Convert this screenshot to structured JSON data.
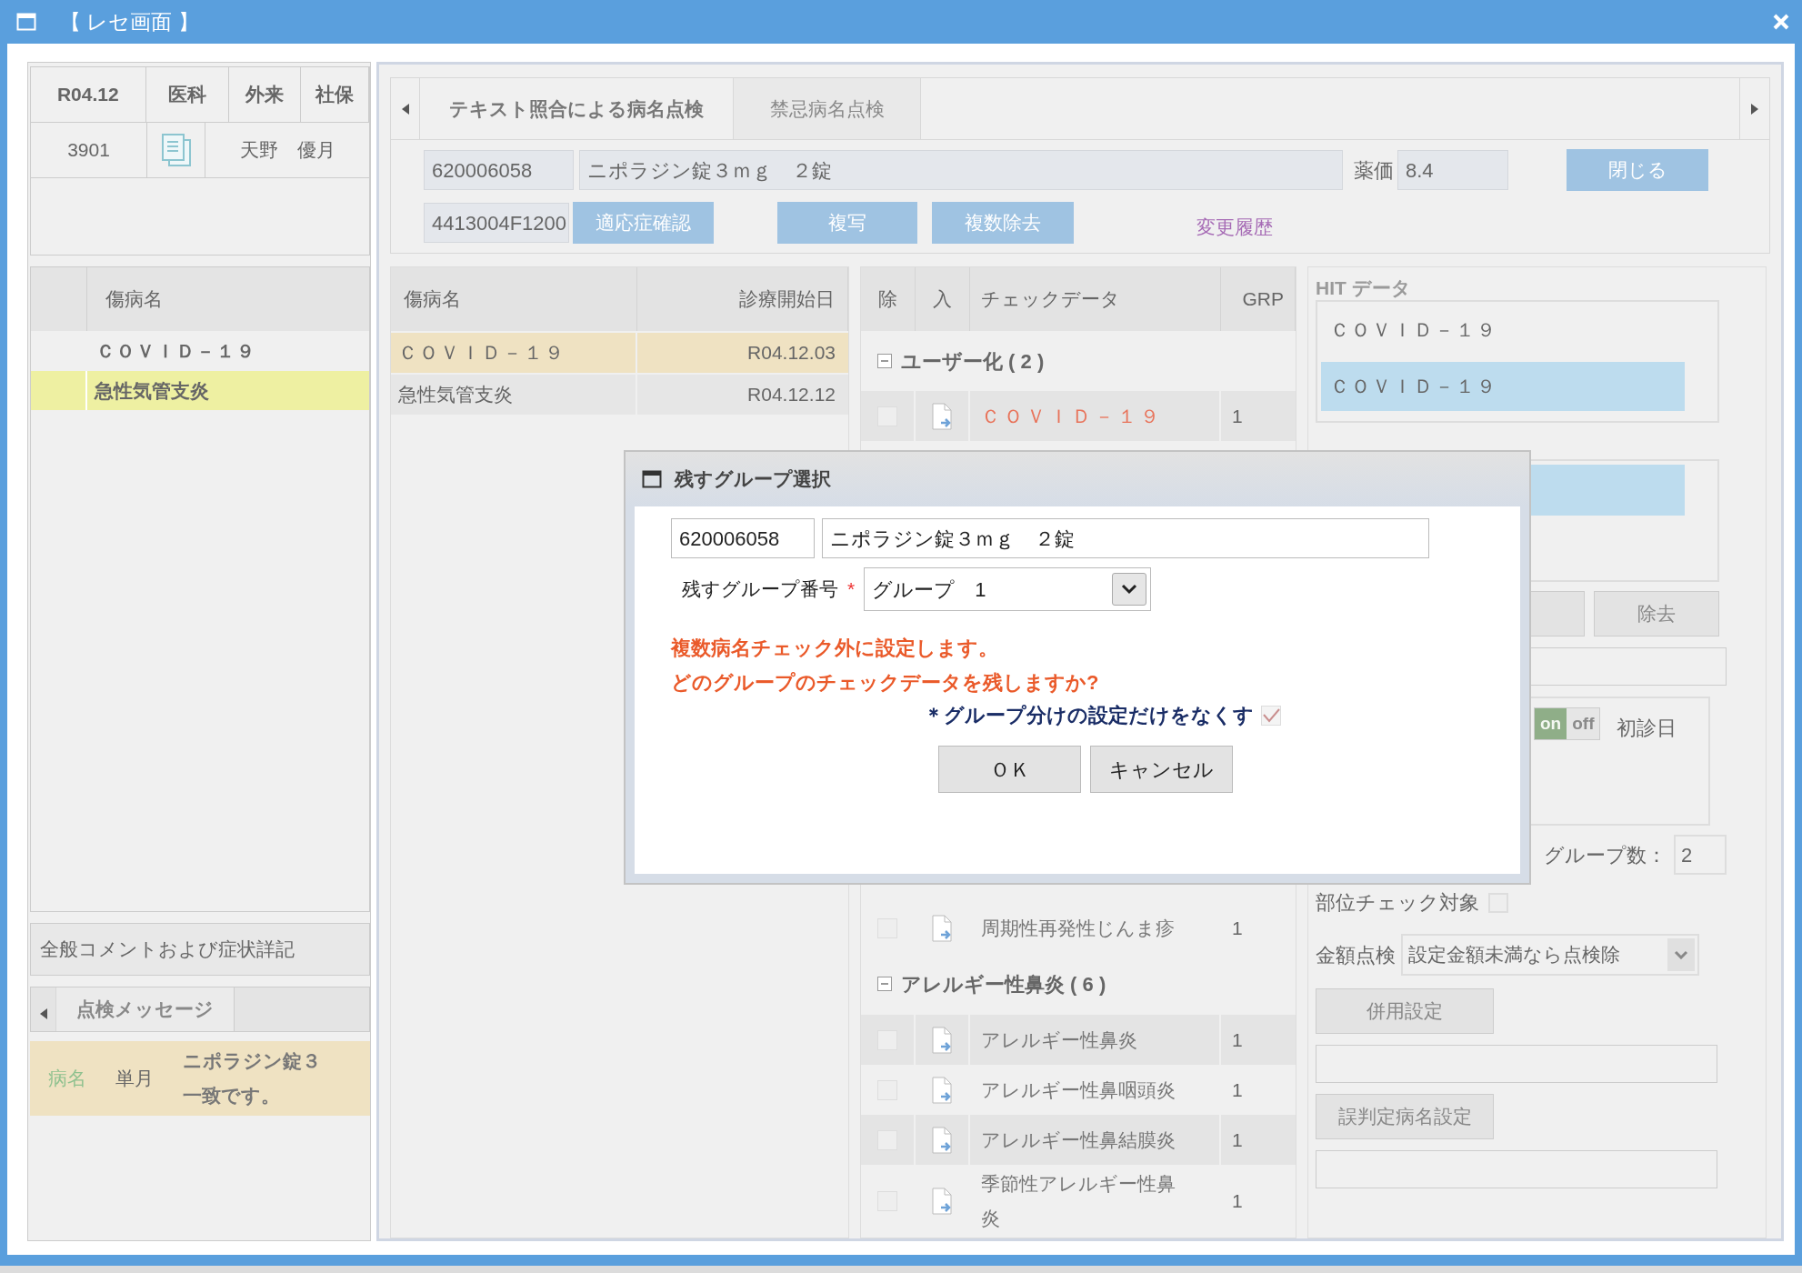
{
  "window": {
    "title": "【 レセ画面 】"
  },
  "patient": {
    "header": [
      "R04.12",
      "医科",
      "外来",
      "社保"
    ],
    "id": "3901",
    "name": "天野　優月"
  },
  "disease_list": {
    "column": "傷病名",
    "rows": [
      {
        "name": "ＣＯＶＩＤ－１９",
        "selected": false
      },
      {
        "name": "急性気管支炎",
        "selected": true
      }
    ]
  },
  "comment_bar": "全般コメントおよび症状詳記",
  "message_tabs": [
    {
      "label": "点検メッセージ",
      "selected": true
    }
  ],
  "messages": [
    {
      "category": "病名",
      "period": "単月",
      "lines": [
        "ニポラジン錠３",
        "一致です。"
      ]
    }
  ],
  "main_tabs": [
    {
      "label": "テキスト照合による病名点検",
      "selected": true
    },
    {
      "label": "禁忌病名点検",
      "selected": false
    }
  ],
  "drug": {
    "code": "620006058",
    "name": "ニポラジン錠３ｍｇ　２錠",
    "price_label": "薬価",
    "price": "8.4",
    "close": "閉じる",
    "yj_code": "4413004F1200",
    "buttons": [
      "適応症確認",
      "複写",
      "複数除去"
    ],
    "history_link": "変更履歴"
  },
  "diseases": {
    "columns": [
      "傷病名",
      "診療開始日"
    ],
    "rows": [
      {
        "name": "ＣＯＶＩＤ－１９",
        "date": "R04.12.03",
        "selected": true
      },
      {
        "name": "急性気管支炎",
        "date": "R04.12.12",
        "selected": false
      }
    ]
  },
  "check_data": {
    "columns": [
      "除",
      "入",
      "チェックデータ",
      "GRP"
    ],
    "groups": [
      {
        "label": "ユーザー化 ( 2 )",
        "expanded": true,
        "items": [
          {
            "name": "ＣＯＶＩＤ－１９",
            "grp": "1",
            "flagged": true,
            "checked": false
          },
          {
            "name": "周期性再発性じんま疹",
            "grp": "1",
            "flagged": false,
            "checked": false
          }
        ]
      },
      {
        "label": "アレルギー性鼻炎 ( 6 )",
        "expanded": true,
        "items": [
          {
            "name": "アレルギー性鼻炎",
            "grp": "1",
            "flagged": false,
            "checked": false
          },
          {
            "name": "アレルギー性鼻咽頭炎",
            "grp": "1",
            "flagged": false,
            "checked": false
          },
          {
            "name": "アレルギー性鼻結膜炎",
            "grp": "1",
            "flagged": false,
            "checked": false
          },
          {
            "name": "季節性アレルギー性鼻炎",
            "grp": "1",
            "flagged": false,
            "checked": false
          }
        ]
      }
    ]
  },
  "hit": {
    "label": "HIT データ",
    "items": [
      {
        "name": "ＣＯＶＩＤ－１９",
        "selected": false
      },
      {
        "name": "ＣＯＶＩＤ－１９",
        "selected": true
      }
    ],
    "remove_button": "除去",
    "toggle": [
      {
        "label": "on",
        "selected": true
      },
      {
        "label": "off",
        "selected": false
      }
    ],
    "first_visit_label": "初診日",
    "group_count_label": "グループ数：",
    "group_count": "2",
    "site_check_label": "部位チェック対象",
    "site_check": false,
    "amount_label": "金額点検",
    "amount_value": "設定金額未満なら点検除",
    "combo_button": "併用設定",
    "misjudge_button": "誤判定病名設定"
  },
  "dialog": {
    "title": "残すグループ選択",
    "code": "620006058",
    "drug": "ニポラジン錠３ｍｇ　２錠",
    "group_label": "残すグループ番号",
    "required_mark": "*",
    "group_value": "グループ　1",
    "message": [
      "複数病名チェック外に設定します。",
      "どのグループのチェックデータを残しますか?"
    ],
    "clear_label": "＊グループ分けの設定だけをなくす",
    "clear_checked": true,
    "buttons": [
      "ＯＫ",
      "キャンセル"
    ]
  }
}
